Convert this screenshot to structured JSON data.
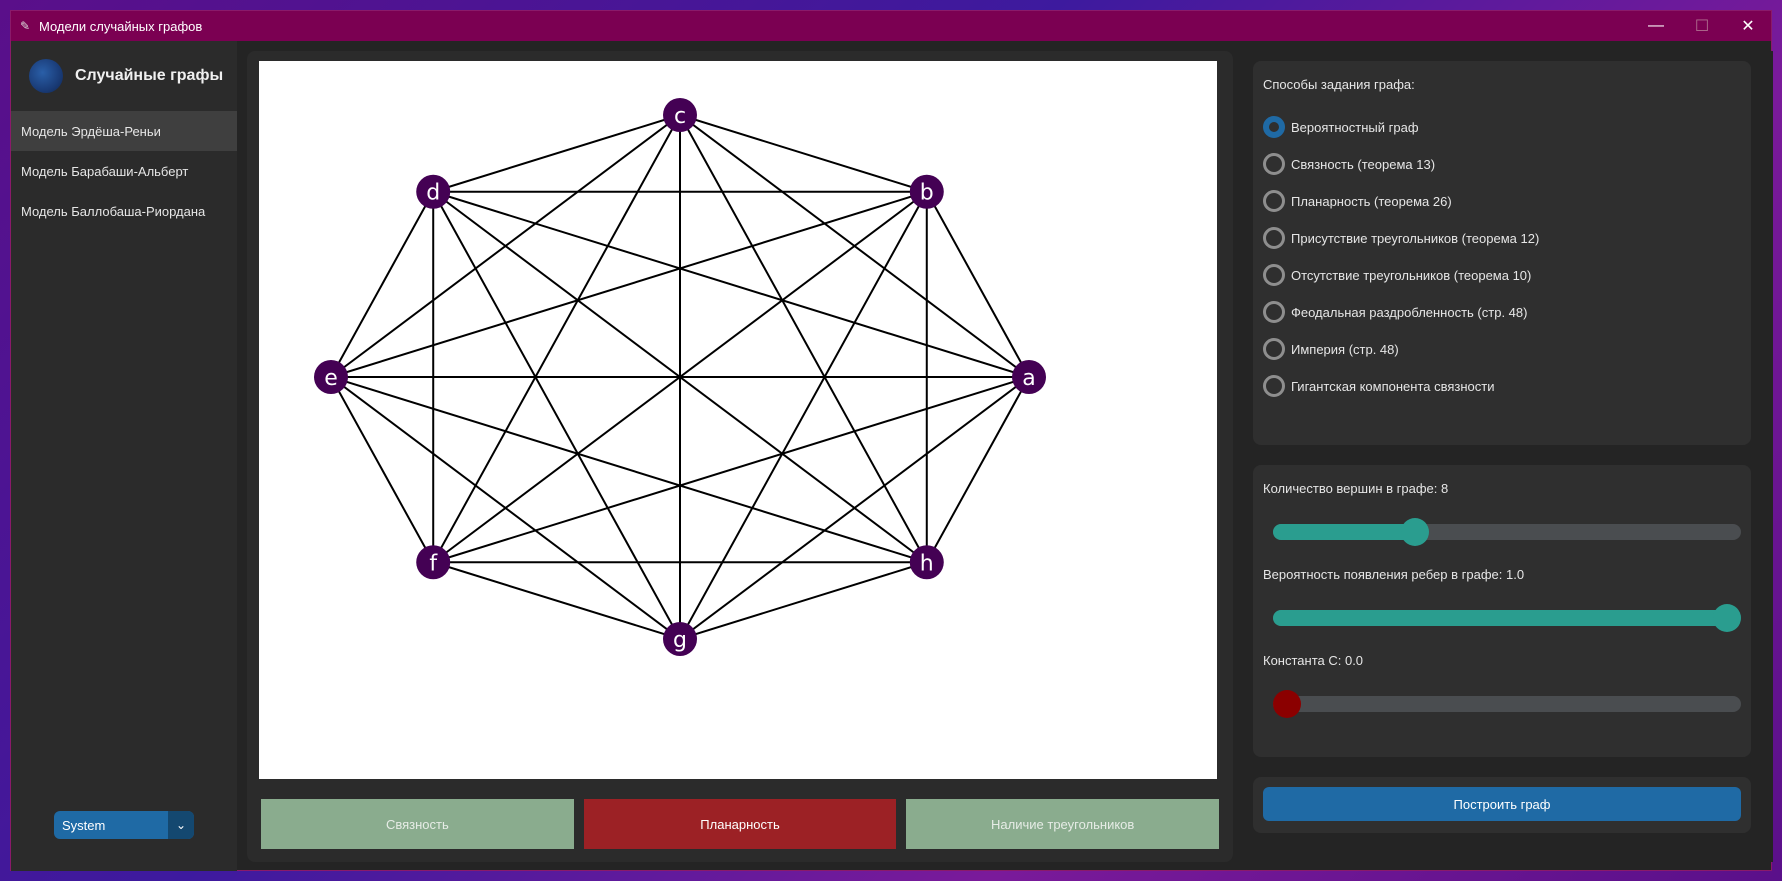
{
  "window": {
    "title": "Модели случайных графов",
    "minimize": "—",
    "maximize": "☐",
    "close": "✕"
  },
  "sidebar": {
    "logo_text": "Случайные графы",
    "items": [
      {
        "label": "Модель Эрдёша-Реньи",
        "active": true
      },
      {
        "label": "Модель Барабаши-Альберт",
        "active": false
      },
      {
        "label": "Модель Баллобаша-Риордана",
        "active": false
      }
    ],
    "theme_value": "System",
    "theme_arrow": "⌄"
  },
  "graph": {
    "node_color": "#440154",
    "nodes": [
      {
        "label": "a"
      },
      {
        "label": "b"
      },
      {
        "label": "c"
      },
      {
        "label": "d"
      },
      {
        "label": "e"
      },
      {
        "label": "f"
      },
      {
        "label": "g"
      },
      {
        "label": "h"
      }
    ],
    "complete": true
  },
  "actions": {
    "connectivity": "Связность",
    "planarity": "Планарность",
    "triangles": "Наличие треугольников"
  },
  "methods": {
    "title": "Способы задания графа:",
    "options": [
      {
        "label": "Вероятностный граф",
        "checked": true
      },
      {
        "label": "Связность (теорема 13)",
        "checked": false
      },
      {
        "label": "Планарность (теорема 26)",
        "checked": false
      },
      {
        "label": "Присутствие треугольников (теорема 12)",
        "checked": false
      },
      {
        "label": "Отсутствие треугольников (теорема 10)",
        "checked": false
      },
      {
        "label": "Феодальная раздробленность (стр. 48)",
        "checked": false
      },
      {
        "label": "Империя (стр. 48)",
        "checked": false
      },
      {
        "label": "Гигантская компонента связности",
        "checked": false
      }
    ]
  },
  "params": {
    "vertices_label": "Количество вершин в графе: 8",
    "vertices_fraction": 0.29,
    "probability_label": "Вероятность появления ребер в графе: 1.0",
    "probability_fraction": 1.0,
    "constant_label": "Константа C: 0.0",
    "constant_fraction": 0.0,
    "slider_color": "#2a9d8f",
    "constant_color": "#8b0000"
  },
  "build": {
    "label": "Построить граф"
  }
}
